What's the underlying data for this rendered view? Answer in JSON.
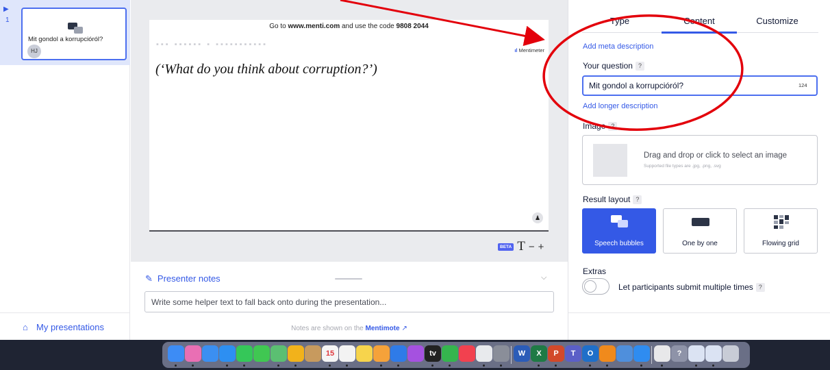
{
  "colors": {
    "accent": "#3459e6",
    "annotation_red": "#e3000b",
    "editor_bg": "#eaebee"
  },
  "rail": {
    "slide_number": "1",
    "marker_icon": "play-triangle-icon",
    "thumbnail": {
      "title": "Mit gondol a korrupcióról?",
      "avatar_initials": "HJ",
      "icon": "speech-bubbles-icon"
    },
    "my_presentations_label": "My presentations",
    "my_presentations_icon": "home-icon"
  },
  "slide": {
    "instruction_prefix": "Go to ",
    "instruction_url": "www.menti.com",
    "instruction_middle": " and use the code ",
    "instruction_code": "9808 2044",
    "brand": "Mentimeter",
    "caption": "(‘What do you think about corruption?’)",
    "participants_icon": "person-icon"
  },
  "font_controls": {
    "beta_badge": "BETA",
    "text_glyph": "T",
    "minus": "−",
    "plus": "+"
  },
  "notes": {
    "title": "Presenter notes",
    "placeholder": "Write some helper text to fall back onto during the presentation...",
    "footer_prefix": "Notes are shown on the",
    "footer_link": "Mentimote"
  },
  "panel": {
    "tabs": [
      {
        "label": "Type",
        "active": false
      },
      {
        "label": "Content",
        "active": true
      },
      {
        "label": "Customize",
        "active": false
      }
    ],
    "add_meta_description": "Add meta description",
    "question_label": "Your question",
    "help_glyph": "?",
    "question_value": "Mit gondol a korrupcióról?",
    "question_chars_left": "124",
    "add_longer_description": "Add longer description",
    "image_label": "Image",
    "image_drop_text": "Drag and drop or click to select an image",
    "image_drop_hint": "Supported file types are .jpg, .png, .svg",
    "result_layout_label": "Result layout",
    "layouts": [
      {
        "label": "Speech bubbles",
        "icon": "speech-bubbles-icon",
        "selected": true
      },
      {
        "label": "One by one",
        "icon": "single-card-icon",
        "selected": false
      },
      {
        "label": "Flowing grid",
        "icon": "grid-icon",
        "selected": false
      }
    ],
    "extras_label": "Extras",
    "extras_toggle_label": "Let participants submit multiple times",
    "extras_toggle_on": false
  },
  "annotation": {
    "type": "red arrow pointing to a red circled question field"
  },
  "dock": {
    "apps": [
      {
        "name": "finder-icon",
        "color": "#3d8cf5"
      },
      {
        "name": "launchpad-icon",
        "color": "#e96fb4"
      },
      {
        "name": "mail-icon",
        "color": "#3b8ff1"
      },
      {
        "name": "app-store-icon",
        "color": "#2d8ff2"
      },
      {
        "name": "facetime-icon",
        "color": "#35c759"
      },
      {
        "name": "messages-icon",
        "color": "#40c752"
      },
      {
        "name": "maps-icon",
        "color": "#5bbf72"
      },
      {
        "name": "photos-icon",
        "color": "#f2b21b"
      },
      {
        "name": "contacts-icon",
        "color": "#c79a5e"
      },
      {
        "name": "calendar-icon",
        "color": "#f5f5f5",
        "text": "15"
      },
      {
        "name": "reminders-icon",
        "color": "#f3f3f3"
      },
      {
        "name": "notes-icon",
        "color": "#f7d44c"
      },
      {
        "name": "freeform-icon",
        "color": "#f5a23a"
      },
      {
        "name": "keynote-icon",
        "color": "#2f7be8"
      },
      {
        "name": "podcasts-icon",
        "color": "#a551e0"
      },
      {
        "name": "apple-tv-icon",
        "color": "#222222",
        "text": "tv"
      },
      {
        "name": "numbers-icon",
        "color": "#35b54e"
      },
      {
        "name": "music-icon",
        "color": "#f2414f"
      },
      {
        "name": "chrome-icon",
        "color": "#e8eaed"
      },
      {
        "name": "system-settings-icon",
        "color": "#8a8e99"
      },
      {
        "name": "word-icon",
        "color": "#2b5cb8",
        "text": "W"
      },
      {
        "name": "excel-icon",
        "color": "#1f7a45",
        "text": "X"
      },
      {
        "name": "powerpoint-icon",
        "color": "#d2492a",
        "text": "P"
      },
      {
        "name": "teams-icon",
        "color": "#5b5fc7",
        "text": "T"
      },
      {
        "name": "outlook-icon",
        "color": "#1f6fc9",
        "text": "O"
      },
      {
        "name": "vlc-icon",
        "color": "#f08a1c"
      },
      {
        "name": "preview-icon",
        "color": "#4f8fdc"
      },
      {
        "name": "safari-icon",
        "color": "#2f8cf0"
      },
      {
        "name": "document-icon",
        "color": "#e8e8ea"
      },
      {
        "name": "help-icon",
        "color": "#8e93a8",
        "text": "?"
      },
      {
        "name": "window-icon",
        "color": "#dbe3f3"
      },
      {
        "name": "window-2-icon",
        "color": "#dbe3f3"
      },
      {
        "name": "trash-icon",
        "color": "#c8ccd6"
      }
    ]
  }
}
